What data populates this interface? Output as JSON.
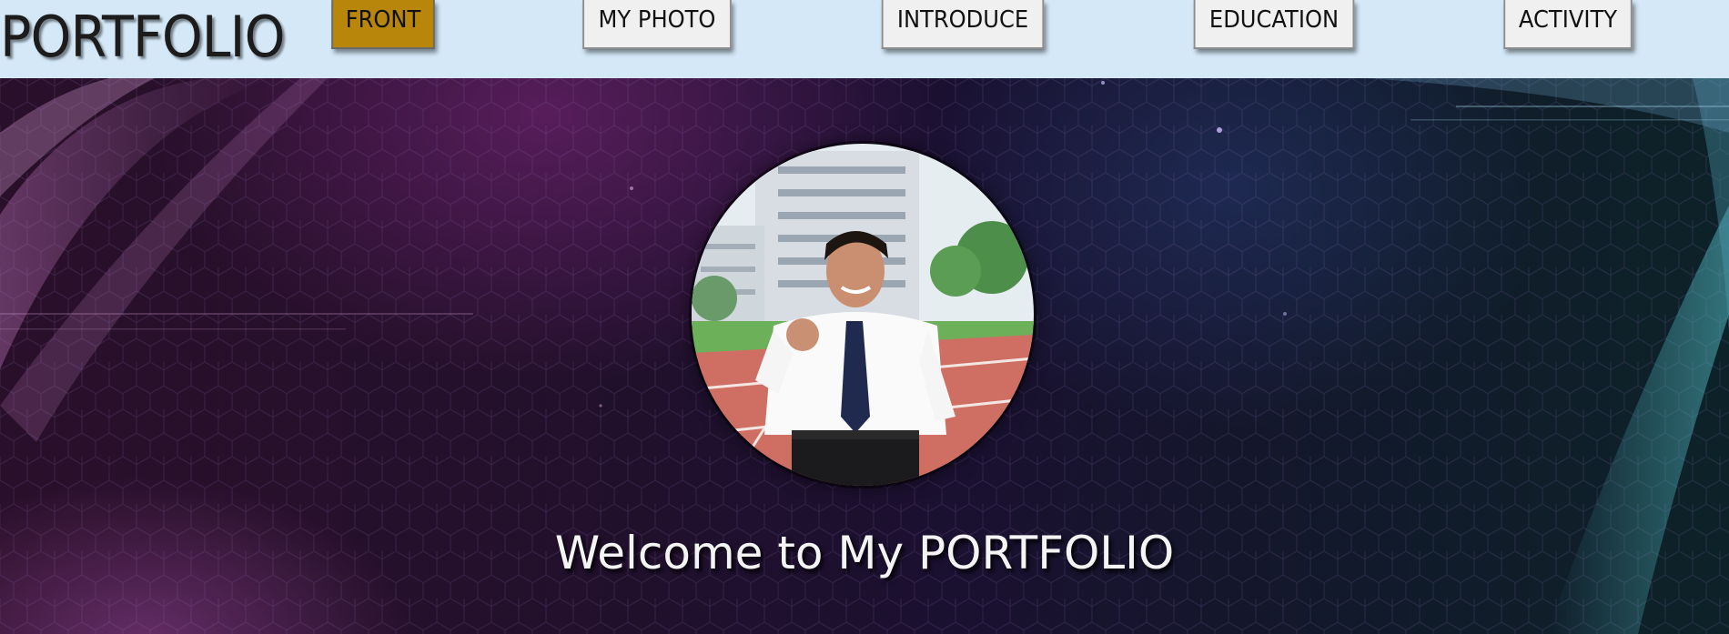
{
  "header": {
    "brand": "PORTFOLIO",
    "background_color": "#d4e8f7",
    "nav": [
      {
        "label": "FRONT",
        "active": true
      },
      {
        "label": "MY PHOTO",
        "active": false
      },
      {
        "label": "INTRODUCE",
        "active": false
      },
      {
        "label": "EDUCATION",
        "active": false
      },
      {
        "label": "ACTIVITY",
        "active": false
      }
    ],
    "active_color": "#b8860b"
  },
  "hero": {
    "welcome_text": "Welcome to My PORTFOLIO",
    "profile_photo": "person-in-white-shirt-and-tie-photo"
  }
}
